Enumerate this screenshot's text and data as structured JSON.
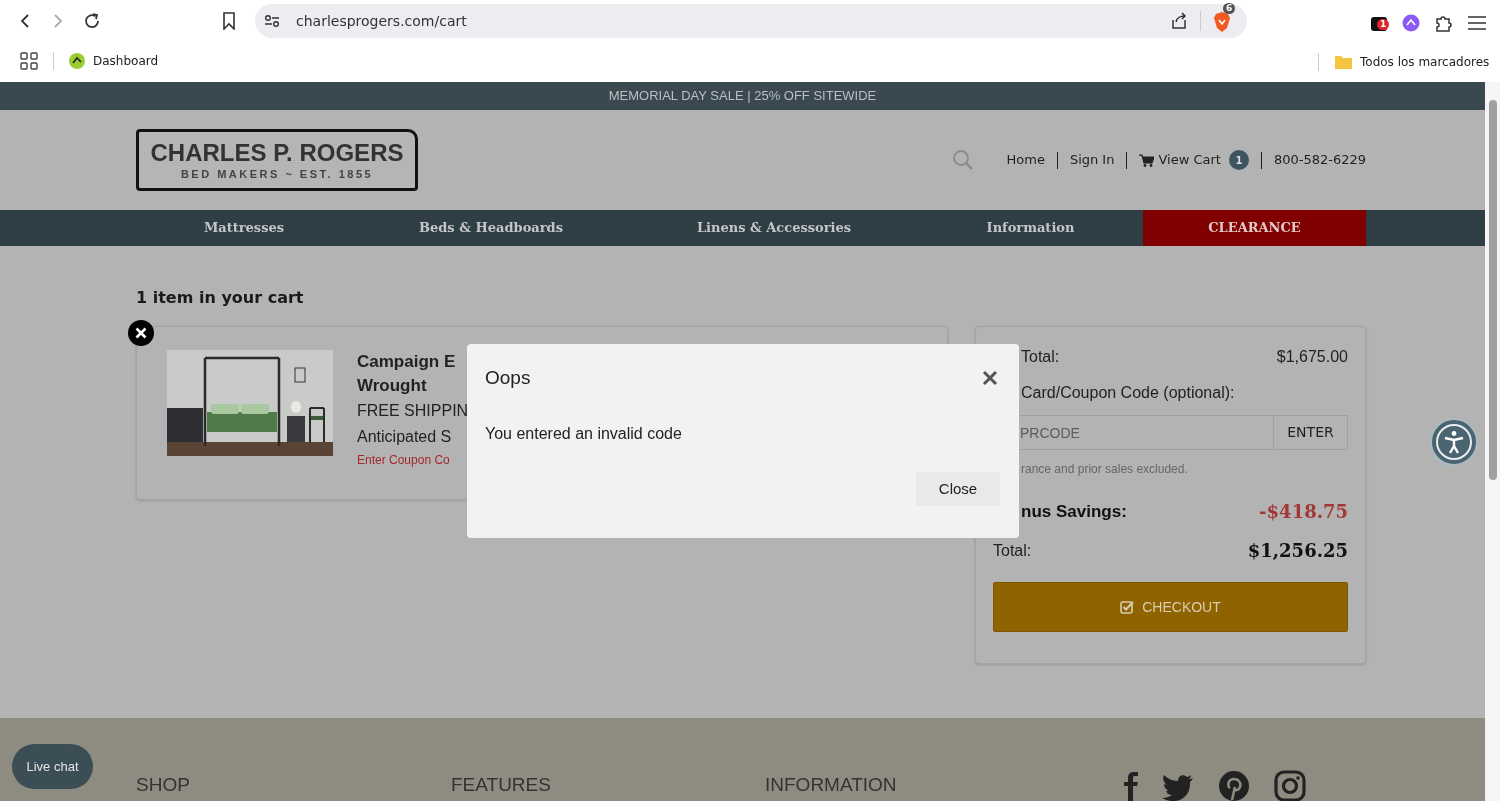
{
  "browser": {
    "url": "charlesprogers.com/cart",
    "brave_badge": "6",
    "extension_badge": "1",
    "bookmarks": [
      {
        "label": "Dashboard"
      }
    ],
    "bookmarks_folder": "Todos los marcadores"
  },
  "banner": "MEMORIAL DAY SALE | 25% OFF SITEWIDE",
  "logo": {
    "title": "CHARLES P. ROGERS",
    "subtitle": "BED MAKERS ~ EST. 1855"
  },
  "header_links": [
    {
      "label": "Home",
      "kind": "link"
    },
    {
      "label": "Sign In",
      "kind": "link"
    },
    {
      "label": "View Cart",
      "kind": "cart",
      "count": "1"
    },
    {
      "label": "800-582-6229",
      "kind": "phone"
    }
  ],
  "nav": [
    {
      "label": "Mattresses",
      "highlighted": false
    },
    {
      "label": "Beds & Headboards",
      "highlighted": false
    },
    {
      "label": "Linens & Accessories",
      "highlighted": false
    },
    {
      "label": "Information",
      "highlighted": false
    },
    {
      "label": "CLEARANCE",
      "highlighted": true
    }
  ],
  "cart": {
    "heading": "1 item in your cart",
    "item": {
      "title_lines": [
        "Campaign E",
        "Wrought"
      ],
      "shipping": "FREE SHIPPIN",
      "anticipated": "Anticipated S",
      "coupon_link": "Enter Coupon Co"
    }
  },
  "summary": {
    "subtotal": {
      "label": "Total:",
      "value": "$1,675.00"
    },
    "coupon_label": "Card/Coupon Code (optional):",
    "coupon_placeholder": "PRCODE",
    "enter_button": "ENTER",
    "note": "rance and prior sales excluded.",
    "savings": {
      "label": "nus Savings:",
      "value": "-$418.75"
    },
    "total": {
      "label": "Total:",
      "value": "$1,256.25"
    },
    "checkout": "CHECKOUT"
  },
  "modal": {
    "title": "Oops",
    "message": "You entered an invalid code",
    "close_button": "Close"
  },
  "footer": {
    "headings": [
      "SHOP",
      "FEATURES",
      "INFORMATION"
    ]
  },
  "live_chat": "Live chat"
}
